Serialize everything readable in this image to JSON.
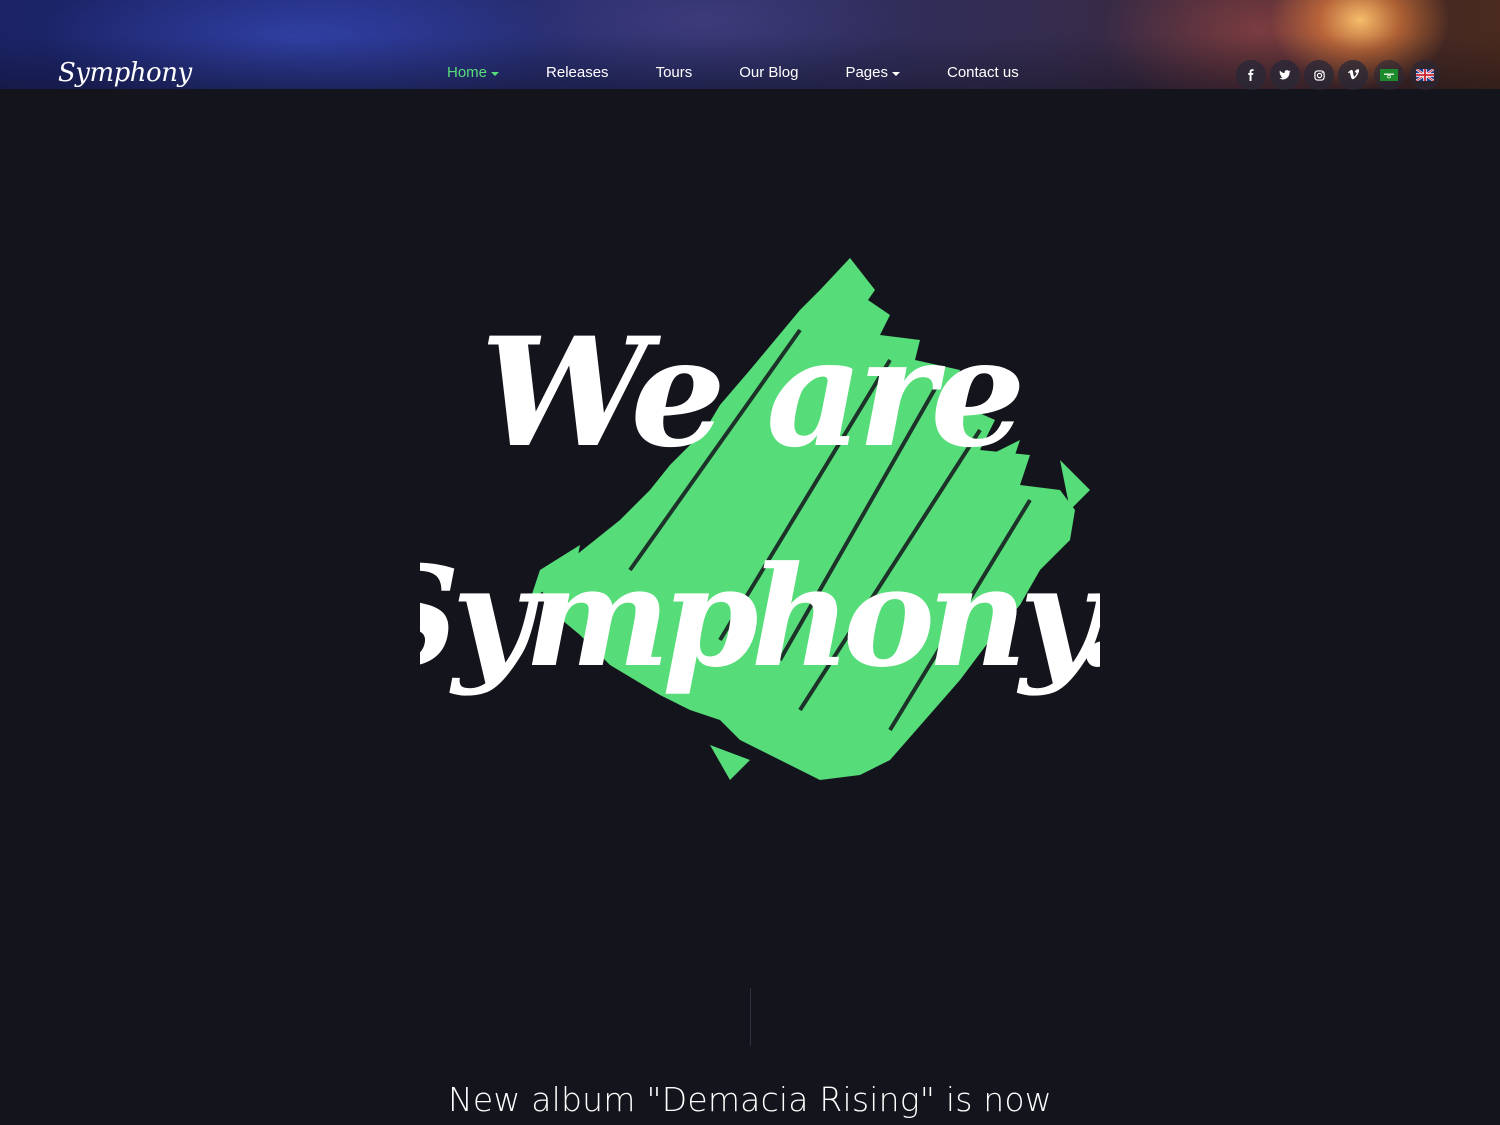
{
  "brand": {
    "logo_text": "Symphony"
  },
  "nav": {
    "items": [
      {
        "label": "Home",
        "has_caret": true,
        "active": true
      },
      {
        "label": "Releases"
      },
      {
        "label": "Tours"
      },
      {
        "label": "Our Blog"
      },
      {
        "label": "Pages",
        "has_caret": true
      },
      {
        "label": "Contact us"
      }
    ]
  },
  "socials": [
    {
      "icon": "facebook-icon",
      "glyph": "f"
    },
    {
      "icon": "twitter-icon",
      "glyph": "t"
    },
    {
      "icon": "instagram-icon",
      "glyph": "◎"
    },
    {
      "icon": "vimeo-icon",
      "glyph": "v"
    }
  ],
  "languages": [
    {
      "icon": "arabic-flag-icon"
    },
    {
      "icon": "uk-flag-icon"
    }
  ],
  "hero": {
    "line1": "We are",
    "line2": "Symphony."
  },
  "announcement": {
    "text": "New album \"Demacia Rising\" is now"
  },
  "colors": {
    "accent": "#56dd79",
    "background": "#14151c",
    "text": "#ffffff"
  }
}
